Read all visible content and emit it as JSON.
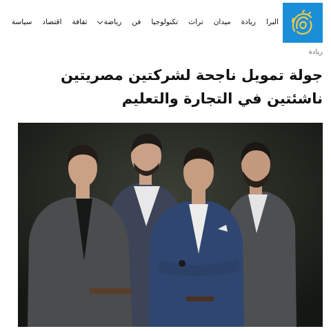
{
  "nav": {
    "items": [
      {
        "label": "سياسة"
      },
      {
        "label": "اقتصاد"
      },
      {
        "label": "ثقافة"
      },
      {
        "label": "رياضة",
        "dropdown": true
      },
      {
        "label": "فن"
      },
      {
        "label": "تكنولوجيا"
      },
      {
        "label": "تراث"
      },
      {
        "label": "ميدان"
      },
      {
        "label": "ريادة"
      },
      {
        "label": "البرا"
      }
    ]
  },
  "logo": {
    "icon": "aljazeera-logo",
    "color": "#1a8fd8"
  },
  "article": {
    "category": "ريادة",
    "title_line1": "جولة تمويل ناجحة لشركتين مصريتين",
    "title_line2": "ناشئتين في التجارة والتعليم"
  }
}
